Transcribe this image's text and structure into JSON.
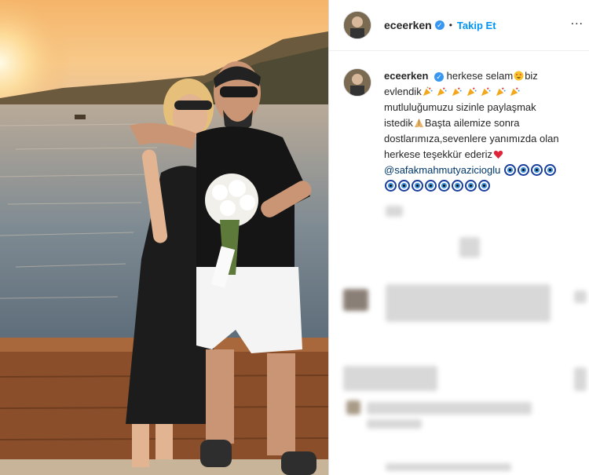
{
  "post": {
    "username": "eceerken",
    "follow_label": "Takip Et",
    "more_label": "...",
    "caption": {
      "line1": "herkese selam",
      "line1b": "biz",
      "line2": "evlendik",
      "line3": "mutluluğumuzu sizinle paylaşmak",
      "line4a": "istedik",
      "line4b": "Başta ailemize sonra",
      "line5": "dostlarımıza,sevenlere yanımızda olan",
      "line6": "herkese teşekkür ederiz",
      "mention": "@safakmahmutyazicioglu"
    }
  },
  "icons": {
    "verified": "verified-badge-icon",
    "star_struck": "star-struck-emoji-icon",
    "party_popper": "party-popper-emoji-icon",
    "folded_hands": "folded-hands-emoji-icon",
    "heart": "red-heart-emoji-icon",
    "nazar": "nazar-amulet-emoji-icon"
  },
  "colors": {
    "follow": "#0095f6",
    "mention": "#00376b",
    "verified": "#3897f0"
  }
}
